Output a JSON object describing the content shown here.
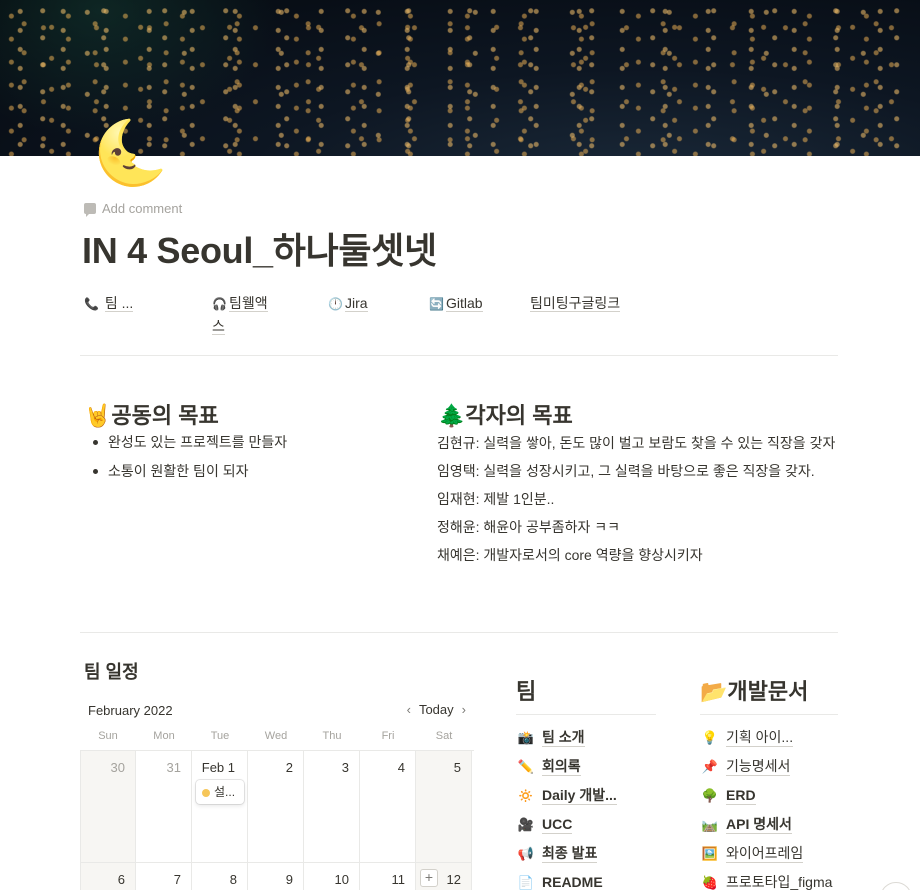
{
  "cover": {
    "description_alt": ""
  },
  "page": {
    "icon": "🌜",
    "add_comment": "Add comment",
    "title": "IN 4 Seoul_하나둘셋넷"
  },
  "links": [
    {
      "icon": "📞",
      "label": "팀 ..."
    },
    {
      "icon": "🎧",
      "label": "팀웰액스"
    },
    {
      "icon": "🕛",
      "label": "Jira"
    },
    {
      "icon": "🔄",
      "label": "Gitlab"
    },
    {
      "icon": "",
      "label": "팀미팅구글링크"
    }
  ],
  "common_goal": {
    "icon": "🤘",
    "heading": "공동의 목표",
    "items": [
      "완성도 있는 프로젝트를 만들자",
      "소통이 원활한 팀이 되자"
    ]
  },
  "each_goal": {
    "icon": "🌲",
    "heading": "각자의 목표",
    "items": [
      "김현규: 실력을 쌓아, 돈도 많이 벌고 보람도 찾을 수 있는 직장을 갖자",
      "임영택: 실력을 성장시키고, 그 실력을 바탕으로 좋은 직장을 갖자.",
      "임재현: 제발 1인분..",
      "정해윤: 해윤아 공부좀하자 ㅋㅋ",
      "채예은: 개발자로서의 core 역량을 향상시키자"
    ]
  },
  "schedule": {
    "title": "팀 일정",
    "month": "February 2022",
    "today_label": "Today",
    "dows": [
      "Sun",
      "Mon",
      "Tue",
      "Wed",
      "Thu",
      "Fri",
      "Sat"
    ],
    "week1": [
      "30",
      "31",
      "Feb 1",
      "2",
      "3",
      "4",
      "5"
    ],
    "week2": [
      "6",
      "7",
      "8",
      "9",
      "10",
      "11",
      "12"
    ],
    "event_label": "설..."
  },
  "team": {
    "heading": "팀",
    "items": [
      {
        "icon": "📸",
        "label": "팀 소개"
      },
      {
        "icon": "✏️",
        "label": "회의록"
      },
      {
        "icon": "🔅",
        "label": "Daily 개발..."
      },
      {
        "icon": "🎥",
        "label": "UCC"
      },
      {
        "icon": "📢",
        "label": "최종 발표"
      },
      {
        "icon": "📄",
        "label": "README"
      }
    ]
  },
  "devdocs": {
    "icon": "📂",
    "heading": "개발문서",
    "items": [
      {
        "icon": "💡",
        "label": "기획 아이..."
      },
      {
        "icon": "📌",
        "label": "기능명세서"
      },
      {
        "icon": "🌳",
        "label": "ERD"
      },
      {
        "icon": "🛤️",
        "label": "API 명세서"
      },
      {
        "icon": "🖼️",
        "label": "와이어프레임"
      },
      {
        "icon": "🍓",
        "label": "프로토타입_figma"
      }
    ]
  }
}
